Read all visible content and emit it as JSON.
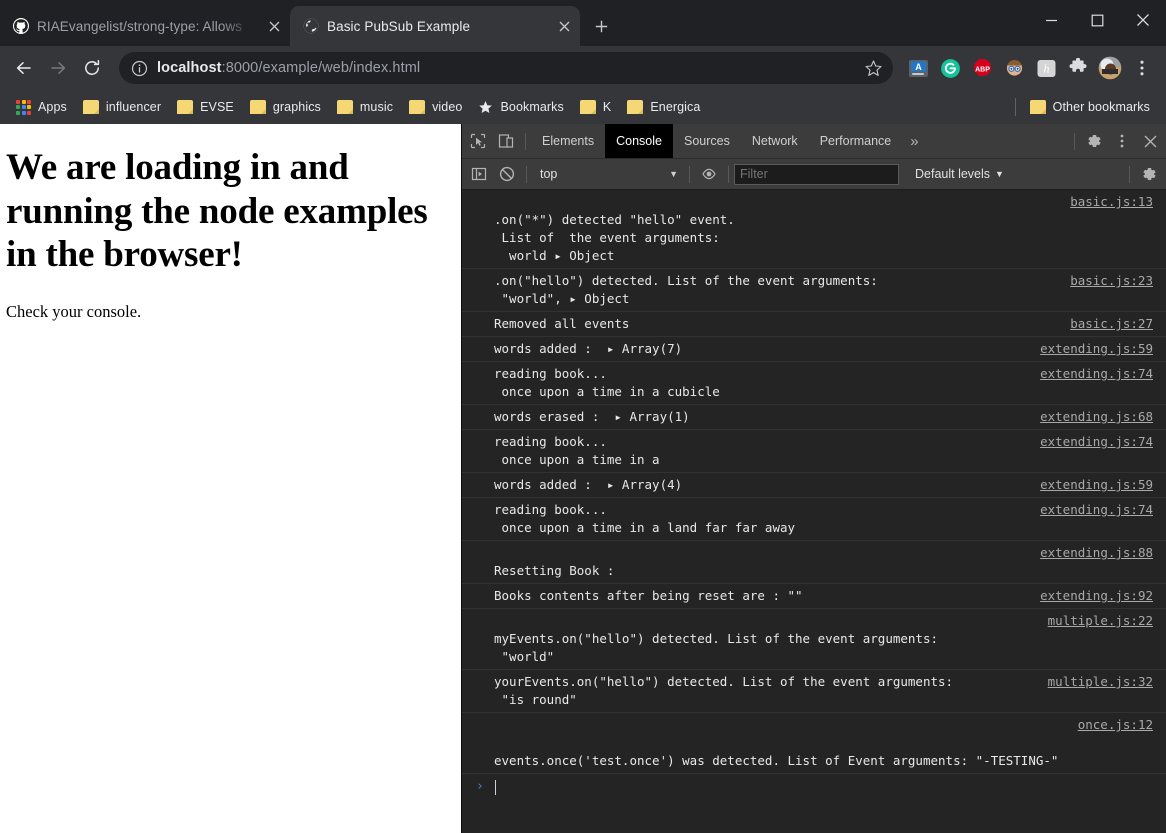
{
  "window": {
    "controls": {
      "minimize": "minimize-window",
      "maximize": "maximize-window",
      "close": "close-window"
    }
  },
  "tabs": [
    {
      "title": "RIAEvangelist/strong-type: Allows",
      "favicon": "github-icon",
      "active": false
    },
    {
      "title": "Basic PubSub Example",
      "favicon": "globe-icon",
      "active": true
    }
  ],
  "newtab_label": "+",
  "toolbar": {
    "back": "back-arrow-icon",
    "forward": "forward-arrow-icon",
    "reload": "reload-icon",
    "url_host": "localhost",
    "url_rest": ":8000/example/web/index.html",
    "url_full": "localhost:8000/example/web/index.html",
    "star": "bookmark-star-icon",
    "extensions": [
      {
        "name": "grammar-extension",
        "label": "A"
      },
      {
        "name": "grammarly-extension",
        "label": "G"
      },
      {
        "name": "adblock-plus-extension",
        "label": "ABP"
      },
      {
        "name": "bitmoji-extension",
        "label": ""
      },
      {
        "name": "honey-extension",
        "label": "h"
      },
      {
        "name": "extensions-puzzle-icon",
        "label": ""
      }
    ],
    "avatar": "profile-avatar",
    "menu": "chrome-menu-icon"
  },
  "bookmarks": {
    "apps_label": "Apps",
    "items": [
      {
        "label": "influencer",
        "icon": "folder-icon"
      },
      {
        "label": "EVSE",
        "icon": "folder-icon"
      },
      {
        "label": "graphics",
        "icon": "folder-icon"
      },
      {
        "label": "music",
        "icon": "folder-icon"
      },
      {
        "label": "video",
        "icon": "folder-icon"
      },
      {
        "label": "Bookmarks",
        "icon": "star-icon"
      },
      {
        "label": "K",
        "icon": "folder-icon"
      },
      {
        "label": "Energica",
        "icon": "folder-icon"
      }
    ],
    "other_label": "Other bookmarks"
  },
  "page": {
    "heading": "We are loading in and running the node examples in the browser!",
    "paragraph": "Check your console."
  },
  "devtools": {
    "inspect_icon": "inspect-element-icon",
    "device_icon": "device-toolbar-icon",
    "tabs": [
      {
        "label": "Elements",
        "active": false
      },
      {
        "label": "Console",
        "active": true
      },
      {
        "label": "Sources",
        "active": false
      },
      {
        "label": "Network",
        "active": false
      },
      {
        "label": "Performance",
        "active": false
      }
    ],
    "more_tabs": "»",
    "settings_icon": "settings-gear-icon",
    "kebab_icon": "more-options-icon",
    "close_icon": "close-devtools-icon",
    "filterbar": {
      "sidebar_toggle": "console-sidebar-icon",
      "clear_icon": "clear-console-icon",
      "context": "top",
      "eye_icon": "live-expressions-icon",
      "filter_placeholder": "Filter",
      "filter_value": "",
      "levels": "Default levels",
      "settings_icon": "console-settings-gear-icon"
    },
    "messages": [
      {
        "lines": [
          "",
          ".on(\"*\") detected \"hello\" event.",
          " List of  the event arguments:",
          "  world ▸ Object"
        ],
        "source": "basic.js:13",
        "src_top": true
      },
      {
        "lines": [
          ".on(\"hello\") detected. List of the event arguments:",
          " \"world\", ▸ Object"
        ],
        "source": "basic.js:23",
        "src_top": true
      },
      {
        "lines": [
          "Removed all events"
        ],
        "source": "basic.js:27",
        "src_top": true
      },
      {
        "lines": [
          "words added :  ▸ Array(7)"
        ],
        "source": "extending.js:59",
        "src_top": true
      },
      {
        "lines": [
          "reading book...",
          " once upon a time in a cubicle"
        ],
        "source": "extending.js:74",
        "src_top": true
      },
      {
        "lines": [
          "words erased :  ▸ Array(1)"
        ],
        "source": "extending.js:68",
        "src_top": true
      },
      {
        "lines": [
          "reading book...",
          " once upon a time in a"
        ],
        "source": "extending.js:74",
        "src_top": true
      },
      {
        "lines": [
          "words added :  ▸ Array(4)"
        ],
        "source": "extending.js:59",
        "src_top": true
      },
      {
        "lines": [
          "reading book...",
          " once upon a time in a land far far away"
        ],
        "source": "extending.js:74",
        "src_top": true
      },
      {
        "lines": [
          "",
          "Resetting Book :"
        ],
        "source": "extending.js:88",
        "src_top": true
      },
      {
        "lines": [
          "Books contents after being reset are : \"\""
        ],
        "source": "extending.js:92",
        "src_top": true
      },
      {
        "lines": [
          "",
          "myEvents.on(\"hello\") detected. List of the event arguments:",
          " \"world\""
        ],
        "source": "multiple.js:22",
        "src_top": false
      },
      {
        "lines": [
          "yourEvents.on(\"hello\") detected. List of the event arguments:",
          " \"is round\""
        ],
        "source": "multiple.js:32",
        "src_top": true
      },
      {
        "lines": [
          "",
          "",
          "events.once('test.once') was detected. List of Event arguments: \"-TESTING-\""
        ],
        "source": "once.js:12",
        "src_top": false
      }
    ],
    "prompt_caret": "›"
  },
  "colors": {
    "chrome_bg": "#202124",
    "toolbar_bg": "#35363a",
    "devtools_bg": "#242424",
    "devtools_toolbar": "#3c3c3c",
    "accent_blue": "#4d7fd6",
    "link": "#a9a9a9",
    "folder_yellow": "#f5d776"
  }
}
